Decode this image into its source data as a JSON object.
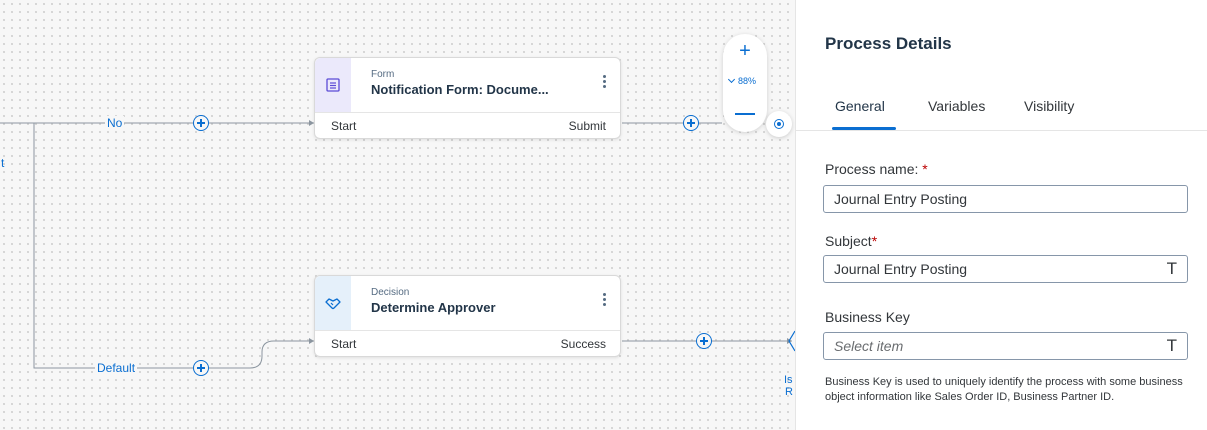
{
  "canvas": {
    "edge_no_label": "No",
    "edge_default_label": "Default",
    "cut_left_text": "t",
    "cut_right_text_1": "Is",
    "cut_right_text_2": "R",
    "zoom": {
      "level": "88%",
      "plus": "+"
    },
    "nodes": [
      {
        "type": "Form",
        "title": "Notification Form: Docume...",
        "start": "Start",
        "end": "Submit",
        "icon": "form-icon"
      },
      {
        "type": "Decision",
        "title": "Determine Approver",
        "start": "Start",
        "end": "Success",
        "icon": "handshake-icon"
      }
    ]
  },
  "panel": {
    "title": "Process Details",
    "tabs": [
      {
        "label": "General",
        "active": true
      },
      {
        "label": "Variables",
        "active": false
      },
      {
        "label": "Visibility",
        "active": false
      }
    ],
    "fields": {
      "process_name": {
        "label": "Process name:",
        "value": "Journal Entry Posting",
        "required": "*"
      },
      "subject": {
        "label": "Subject",
        "value": "Journal Entry Posting",
        "required": "*"
      },
      "business_key": {
        "label": "Business Key",
        "placeholder": "Select item"
      }
    },
    "text_glyph": "T",
    "hint": "Business Key is used to uniquely identify the process with some business object information like Sales Order ID, Business Partner ID."
  },
  "colors": {
    "accent": "#0a6ed1",
    "title": "#223548",
    "required": "#bb0000"
  }
}
